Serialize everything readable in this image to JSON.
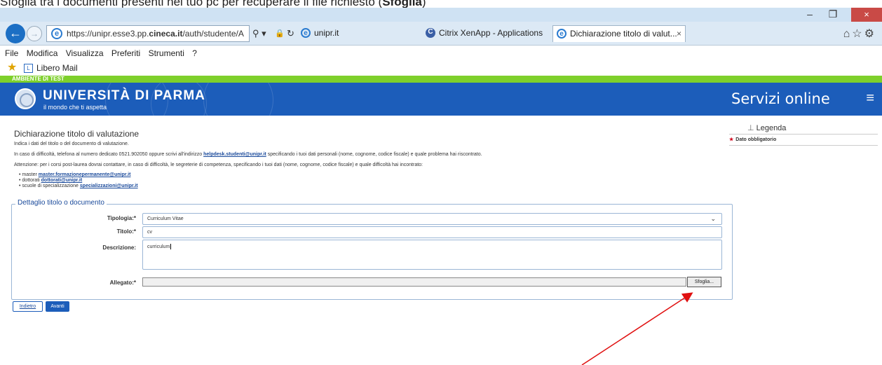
{
  "caption": {
    "text_before": "Sfoglia tra i documenti presenti nel tuo pc per recuperare il file richiesto (",
    "bold": "Sfoglia",
    "text_after": ")"
  },
  "window": {
    "minimize": "–",
    "maximize": "❐",
    "close": "×"
  },
  "browser": {
    "back": "←",
    "forward": "→",
    "url_prefix": "https://unipr.esse3.pp.",
    "url_domain": "cineca.it",
    "url_suffix": "/auth/studente/A",
    "addr_search": "⚲ ▾",
    "addr_lock": "🔒",
    "addr_refresh": "↻",
    "tabs": [
      {
        "label": "unipr.it",
        "icon": "e",
        "icon_color": "#2a7bd0"
      },
      {
        "label": "Citrix XenApp - Applications",
        "icon": "C",
        "icon_color": "#3a5fa6"
      },
      {
        "label": "Dichiarazione titolo di valut...",
        "icon": "e",
        "icon_color": "#2a7bd0",
        "close": "×"
      }
    ],
    "toolbar_icons": "⌂☆⚙"
  },
  "menu": [
    "File",
    "Modifica",
    "Visualizza",
    "Preferiti",
    "Strumenti",
    "?"
  ],
  "favorites": {
    "item": "Libero Mail",
    "icon": "L"
  },
  "environment": "AMBIENTE DI TEST",
  "header": {
    "university": "UNIVERSITÀ DI PARMA",
    "tagline": "il mondo che ti aspetta",
    "service": "Servizi online",
    "menu_icon": "≡"
  },
  "page": {
    "title": "Dichiarazione titolo di valutazione",
    "intro": "Indica i dati del titolo o del documento di valutazione.",
    "help_before": "In caso di difficoltà, telefona al numero dedicato 0521.902050 oppure scrivi all'indirizzo ",
    "help_email": "helpdesk.studenti@unipr.it",
    "help_after": " specificando i tuoi dati personali (nome, cognome, codice fiscale) e quale problema hai riscontrato.",
    "attention": "Attenzione: per i corsi post-laurea dovrai contattare, in caso di difficoltà, le segreterie di competenza, specificando i tuoi dati (nome, cognome, codice fiscale) e quale difficoltà hai incontrato:",
    "contacts": [
      {
        "label": "master ",
        "email": "master.formazionepermanente@unipr.it"
      },
      {
        "label": "dottorati ",
        "email": "dottorati@unipr.it"
      },
      {
        "label": "scuole di specializzazione ",
        "email": "specializzazioni@unipr.it"
      }
    ]
  },
  "legend": {
    "title": "Legenda",
    "required": "Dato obbligatorio"
  },
  "form": {
    "legend": "Dettaglio titolo o documento",
    "tipologia_label": "Tipologia:*",
    "tipologia_value": "Curriculum Vitae",
    "titolo_label": "Titolo:*",
    "titolo_value": "cv",
    "descrizione_label": "Descrizione:",
    "descrizione_value": "curriculum",
    "allegato_label": "Allegato:*",
    "allegato_value": "",
    "browse_button": "Sfoglia..."
  },
  "buttons": {
    "back": "Indietro",
    "next": "Avanti"
  },
  "annotation": {
    "arrow_color": "#e01010"
  }
}
